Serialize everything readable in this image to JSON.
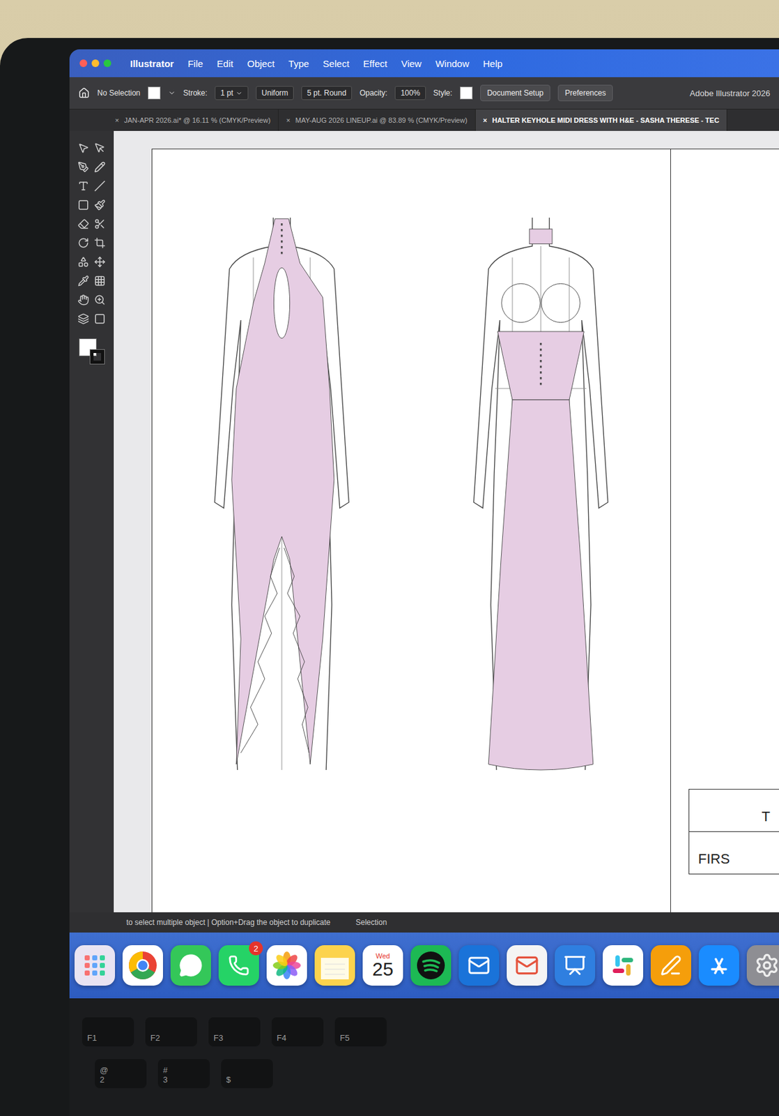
{
  "menu_bar": {
    "app": "Illustrator",
    "items": [
      "File",
      "Edit",
      "Object",
      "Type",
      "Select",
      "Effect",
      "View",
      "Window",
      "Help"
    ]
  },
  "control_bar": {
    "selection": "No Selection",
    "stroke_label": "Stroke:",
    "stroke_weight": "1 pt",
    "profile": "Uniform",
    "brush": "5 pt. Round",
    "opacity_label": "Opacity:",
    "opacity": "100%",
    "style_label": "Style:",
    "buttons": [
      "Document Setup",
      "Preferences"
    ],
    "app_title": "Adobe Illustrator 2026"
  },
  "tabs": [
    {
      "label": "JAN-APR 2026.ai* @ 16.11 % (CMYK/Preview)",
      "close": "×",
      "selected": false
    },
    {
      "label": "MAY-AUG 2026 LINEUP.ai @ 83.89 % (CMYK/Preview)",
      "close": "×",
      "selected": false
    },
    {
      "label": "HALTER KEYHOLE MIDI DRESS WITH H&E - SASHA THERESE - TEC",
      "close": "×",
      "selected": true
    }
  ],
  "title_block": [
    "T",
    "FIRS"
  ],
  "status_bar": {
    "hint": "to select multiple object | Option+Drag the object to duplicate",
    "tool": "Selection"
  },
  "dock": [
    {
      "kind": "launchpad",
      "color": "#e9e4f2"
    },
    {
      "kind": "chrome",
      "color": "#ffffff"
    },
    {
      "kind": "messages",
      "color": "#34c759"
    },
    {
      "kind": "whatsapp",
      "color": "#25d366",
      "badge": "2"
    },
    {
      "kind": "photos",
      "color": "#ffffff"
    },
    {
      "kind": "notes",
      "color": "#fcd34d"
    },
    {
      "kind": "calendar",
      "color": "#ffffff",
      "day": "Wed",
      "date": "25"
    },
    {
      "kind": "spotify",
      "color": "#1db954"
    },
    {
      "kind": "outlook",
      "color": "#1a73d9"
    },
    {
      "kind": "mail",
      "color": "#f4f4f4"
    },
    {
      "kind": "keynote",
      "color": "#2f7fe0"
    },
    {
      "kind": "slack",
      "color": "#ffffff"
    },
    {
      "kind": "pages",
      "color": "#f59e0b"
    },
    {
      "kind": "appstore",
      "color": "#1a8cff"
    },
    {
      "kind": "settings",
      "color": "#8e8e93"
    }
  ],
  "keyboard": {
    "function_keys": [
      "F1",
      "F2",
      "F3",
      "F4",
      "F5"
    ],
    "number_keys": [
      {
        "symbol": "@",
        "digit": "2"
      },
      {
        "symbol": "#",
        "digit": "3"
      },
      {
        "symbol": "$",
        "digit": ""
      }
    ]
  }
}
